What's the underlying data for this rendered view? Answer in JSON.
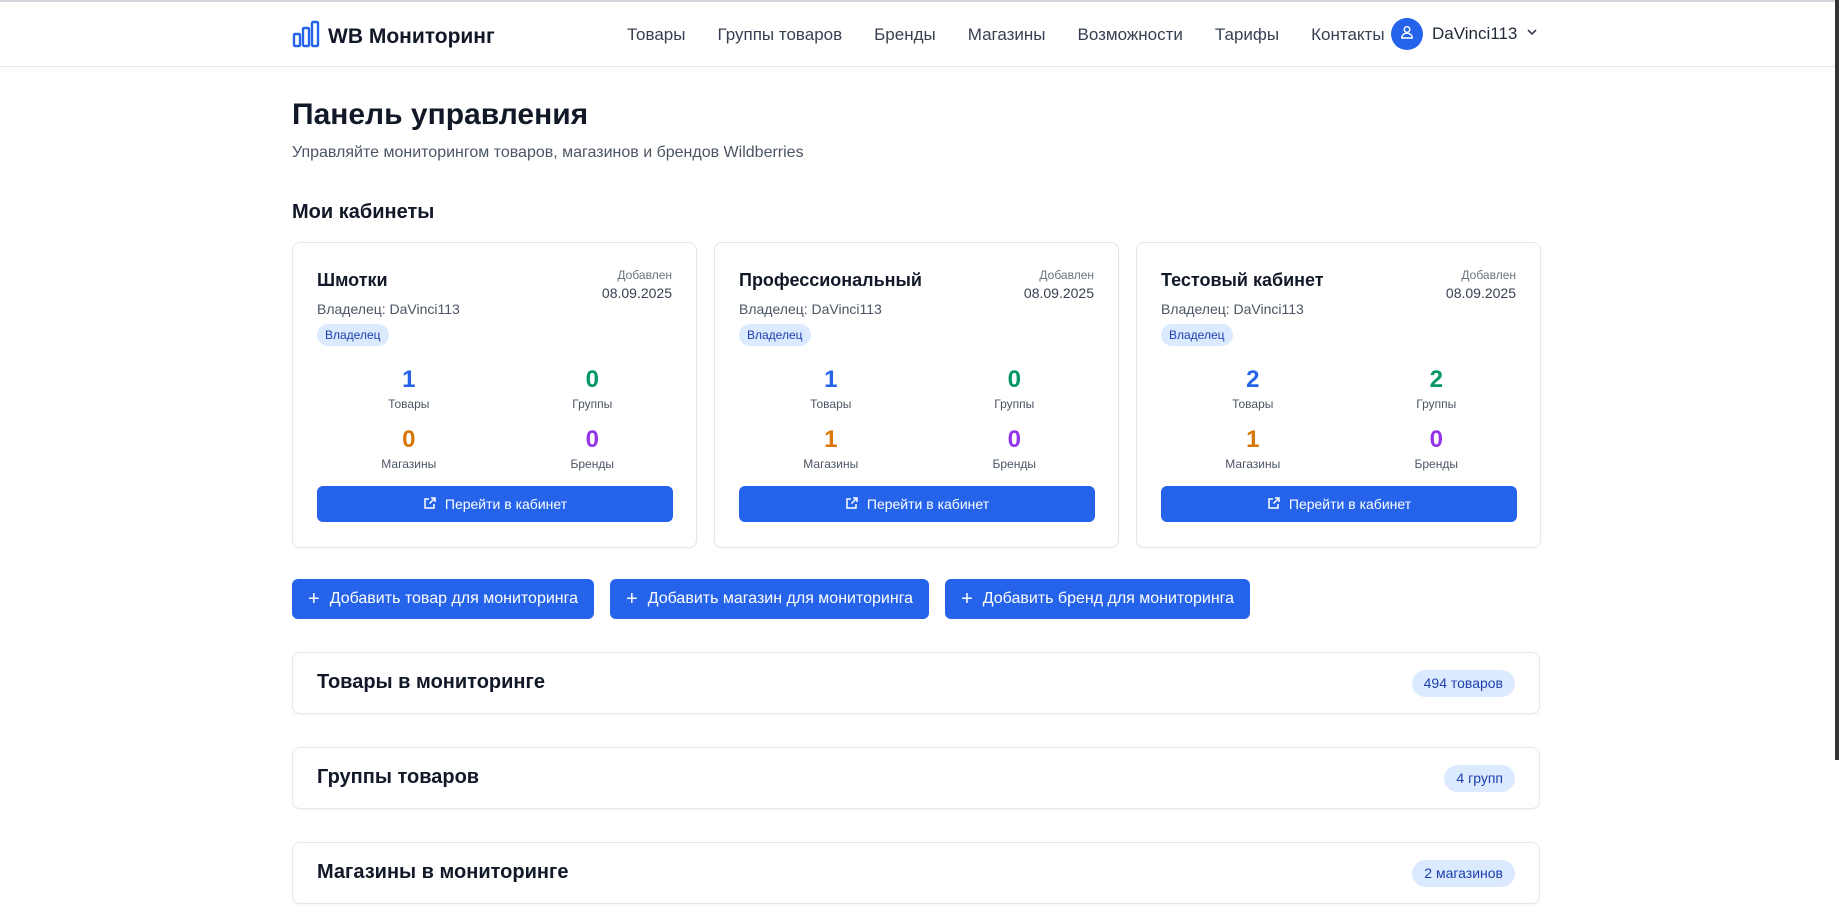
{
  "header": {
    "logo_text": "WB Мониторинг",
    "nav": [
      "Товары",
      "Группы товаров",
      "Бренды",
      "Магазины",
      "Возможности",
      "Тарифы",
      "Контакты"
    ],
    "user_name": "DaVinci113"
  },
  "page": {
    "title": "Панель управления",
    "subtitle": "Управляйте мониторингом товаров, магазинов и брендов Wildberries",
    "cabinets_title": "Мои кабинеты"
  },
  "cabinets": [
    {
      "name": "Шмотки",
      "added_label": "Добавлен",
      "added_date": "08.09.2025",
      "owner": "Владелец: DaVinci113",
      "badge": "Владелец",
      "stats": {
        "products": "1",
        "groups": "0",
        "shops": "0",
        "brands": "0"
      },
      "labels": {
        "products": "Товары",
        "groups": "Группы",
        "shops": "Магазины",
        "brands": "Бренды"
      },
      "button": "Перейти в кабинет"
    },
    {
      "name": "Профессиональный",
      "added_label": "Добавлен",
      "added_date": "08.09.2025",
      "owner": "Владелец: DaVinci113",
      "badge": "Владелец",
      "stats": {
        "products": "1",
        "groups": "0",
        "shops": "1",
        "brands": "0"
      },
      "labels": {
        "products": "Товары",
        "groups": "Группы",
        "shops": "Магазины",
        "brands": "Бренды"
      },
      "button": "Перейти в кабинет"
    },
    {
      "name": "Тестовый кабинет",
      "added_label": "Добавлен",
      "added_date": "08.09.2025",
      "owner": "Владелец: DaVinci113",
      "badge": "Владелец",
      "stats": {
        "products": "2",
        "groups": "2",
        "shops": "1",
        "brands": "0"
      },
      "labels": {
        "products": "Товары",
        "groups": "Группы",
        "shops": "Магазины",
        "brands": "Бренды"
      },
      "button": "Перейти в кабинет"
    }
  ],
  "actions": {
    "add_product": "Добавить товар для мониторинга",
    "add_shop": "Добавить магазин для мониторинга",
    "add_brand": "Добавить бренд для мониторинга"
  },
  "panels": [
    {
      "title": "Товары в мониторинге",
      "badge": "494 товаров"
    },
    {
      "title": "Группы товаров",
      "badge": "4 групп"
    },
    {
      "title": "Магазины в мониторинге",
      "badge": "2 магазинов"
    }
  ],
  "colors": {
    "accent": "#2563eb",
    "stat_products": "#2563eb",
    "stat_groups": "#059669",
    "stat_shops": "#d97706",
    "stat_brands": "#9333ea",
    "badge_bg": "#dbeafe"
  },
  "icons": {
    "logo": "bar-chart-icon",
    "user": "user-icon",
    "dropdown": "chevron-down-icon",
    "open_cabinet": "external-link-icon",
    "add": "plus-icon"
  }
}
